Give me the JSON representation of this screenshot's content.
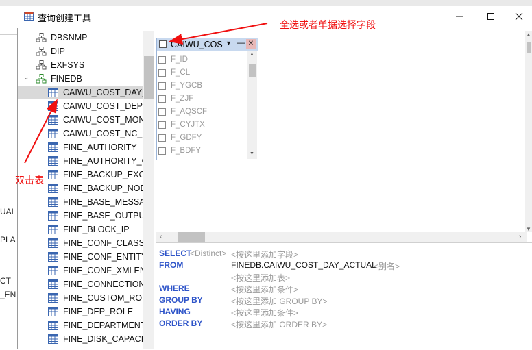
{
  "window": {
    "title": "查询创建工具",
    "minimize_glyph": "—",
    "maximize_glyph": "☐",
    "close_glyph": "✕"
  },
  "background_app": {
    "fragments": [
      "UAL",
      "PLAN",
      "CT",
      "_ENT"
    ]
  },
  "tree": {
    "items": [
      {
        "label": "DBSNMP",
        "type": "schema"
      },
      {
        "label": "DIP",
        "type": "schema"
      },
      {
        "label": "EXFSYS",
        "type": "schema"
      },
      {
        "label": "FINEDB",
        "type": "schema-open"
      },
      {
        "label": "CAIWU_COST_DAY_ACTUAL",
        "type": "table",
        "selected": true
      },
      {
        "label": "CAIWU_COST_DEPT",
        "type": "table"
      },
      {
        "label": "CAIWU_COST_MONTH",
        "type": "table"
      },
      {
        "label": "CAIWU_COST_NC_BA",
        "type": "table"
      },
      {
        "label": "FINE_AUTHORITY",
        "type": "table"
      },
      {
        "label": "FINE_AUTHORITY_OBJECT",
        "type": "table"
      },
      {
        "label": "FINE_BACKUP_EXCLUDE",
        "type": "table"
      },
      {
        "label": "FINE_BACKUP_NODE",
        "type": "table"
      },
      {
        "label": "FINE_BASE_MESSAGE",
        "type": "table"
      },
      {
        "label": "FINE_BASE_OUTPUT",
        "type": "table"
      },
      {
        "label": "FINE_BLOCK_IP",
        "type": "table"
      },
      {
        "label": "FINE_CONF_CLASSNAME",
        "type": "table"
      },
      {
        "label": "FINE_CONF_ENTITY",
        "type": "table"
      },
      {
        "label": "FINE_CONF_XMLENTITY",
        "type": "table"
      },
      {
        "label": "FINE_CONNECTION",
        "type": "table"
      },
      {
        "label": "FINE_CUSTOM_ROLE",
        "type": "table"
      },
      {
        "label": "FINE_DEP_ROLE",
        "type": "table"
      },
      {
        "label": "FINE_DEPARTMENT",
        "type": "table"
      },
      {
        "label": "FINE_DISK_CAPACITY",
        "type": "table"
      }
    ]
  },
  "table_box": {
    "name": "CAIWU_COST_DAY_ACTUAL",
    "dropdown_glyph": "▼",
    "minimize_glyph": "—",
    "close_glyph": "✕",
    "fields": [
      "F_ID",
      "F_CL",
      "F_YGCB",
      "F_ZJF",
      "F_AQSCF",
      "F_CYJTX",
      "F_GDFY",
      "F_BDFY"
    ]
  },
  "sql": {
    "select_kw": "SELECT",
    "distinct": "<Distinct>",
    "select_placeholder": "<按这里添加字段>",
    "from_kw": "FROM",
    "from_table": "FINEDB.CAIWU_COST_DAY_ACTUAL",
    "alias_placeholder": "<别名>",
    "from_placeholder": "<按这里添加表>",
    "where_kw": "WHERE",
    "where_placeholder": "<按这里添加条件>",
    "groupby_kw": "GROUP BY",
    "groupby_placeholder": "<按这里添加 GROUP BY>",
    "having_kw": "HAVING",
    "having_placeholder": "<按这里添加条件>",
    "orderby_kw": "ORDER BY",
    "orderby_placeholder": "<按这里添加 ORDER BY>"
  },
  "annotations": {
    "select_hint": "全选或者单据选择字段",
    "double_click_hint": "双击表"
  },
  "colors": {
    "keyword": "#2f55c9",
    "annotation": "#f01010",
    "table_header": "#c8d9ef"
  }
}
